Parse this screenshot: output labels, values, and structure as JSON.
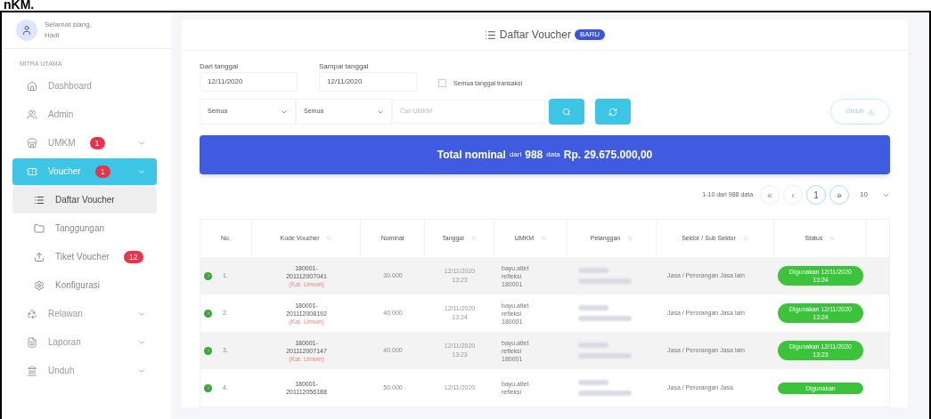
{
  "caption": "nKM.",
  "user": {
    "greeting": "Selamat siang,",
    "name": "Hadi"
  },
  "sidebar": {
    "section": "MITRA UTAMA",
    "items": [
      {
        "label": "Dashboard",
        "selected": false,
        "expandable": false
      },
      {
        "label": "Admin",
        "selected": false,
        "expandable": false
      },
      {
        "label": "UMKM",
        "badge": "1",
        "selected": false,
        "expandable": true
      },
      {
        "label": "Voucher",
        "badge": "1",
        "selected": true,
        "expandable": true,
        "children": [
          {
            "label": "Daftar Voucher",
            "selected": true
          },
          {
            "label": "Tanggungan",
            "selected": false
          },
          {
            "label": "Tiket Voucher",
            "badge": "12",
            "selected": false
          },
          {
            "label": "Konfigurasi",
            "selected": false
          }
        ]
      },
      {
        "label": "Relawan",
        "selected": false,
        "expandable": true
      },
      {
        "label": "Laporan",
        "selected": false,
        "expandable": true
      },
      {
        "label": "Unduh",
        "selected": false,
        "expandable": true
      }
    ]
  },
  "card": {
    "title": "Daftar Voucher",
    "title_badge": "BARU",
    "filters": {
      "from": {
        "label": "Dari tanggal",
        "value": "12/11/2020"
      },
      "to": {
        "label": "Sampai tanggal",
        "value": "12/11/2020"
      },
      "all_dates": {
        "label": "Semua tanggal transaksi",
        "checked": false
      },
      "select_1": "Semua",
      "select_2": "Semua",
      "search": {
        "placeholder": "Cari UMKM"
      },
      "download": "Unduh"
    },
    "total": {
      "label": "Total nominal",
      "from": "dari",
      "count": "988",
      "unit": "data",
      "amount": "Rp. 29.675.000,00"
    },
    "pagination": {
      "info": "1-10 dari 988 data",
      "first": "«",
      "prev": "‹",
      "page": "1",
      "next": "»",
      "per_page": "10"
    },
    "table": {
      "columns": [
        "No.",
        "Kode Voucher",
        "Nominal",
        "Tanggal",
        "UMKM",
        "Pelanggan",
        "Sektor / Sub Sektor",
        "Status"
      ],
      "rows": [
        {
          "no": "1.",
          "code": "180001-201112007041",
          "category": "(Kat. Umum)",
          "nominal": "30.000",
          "date": "12/11/2020",
          "time": "13:23",
          "umkm": "bayu.atlet refleksi 180001",
          "sector": "Jasa / Perorangan Jasa lain",
          "status": "Digunakan 12/11/2020 13:24"
        },
        {
          "no": "2.",
          "code": "180001-201112008192",
          "category": "(Kat. Umum)",
          "nominal": "40.000",
          "date": "12/11/2020",
          "time": "13:24",
          "umkm": "bayu.atlet refleksi 180001",
          "sector": "Jasa / Perorangan Jasa lain",
          "status": "Digunakan 12/11/2020 13:24"
        },
        {
          "no": "3.",
          "code": "180001-201112007147",
          "category": "(Kat. Umum)",
          "nominal": "40.000",
          "date": "12/11/2020",
          "time": "13:23",
          "umkm": "bayu.atlet refleksi 180001",
          "sector": "Jasa / Perorangan Jasa lain",
          "status": "Digunakan 12/11/2020 13:23"
        },
        {
          "no": "4.",
          "code": "180001-201112056188",
          "nominal": "50.000",
          "date": "12/11/2020",
          "umkm": "bayu.atlet refleksi",
          "sector": "Jasa / Perorangan Jasa",
          "status": "Digunakan"
        }
      ]
    }
  }
}
